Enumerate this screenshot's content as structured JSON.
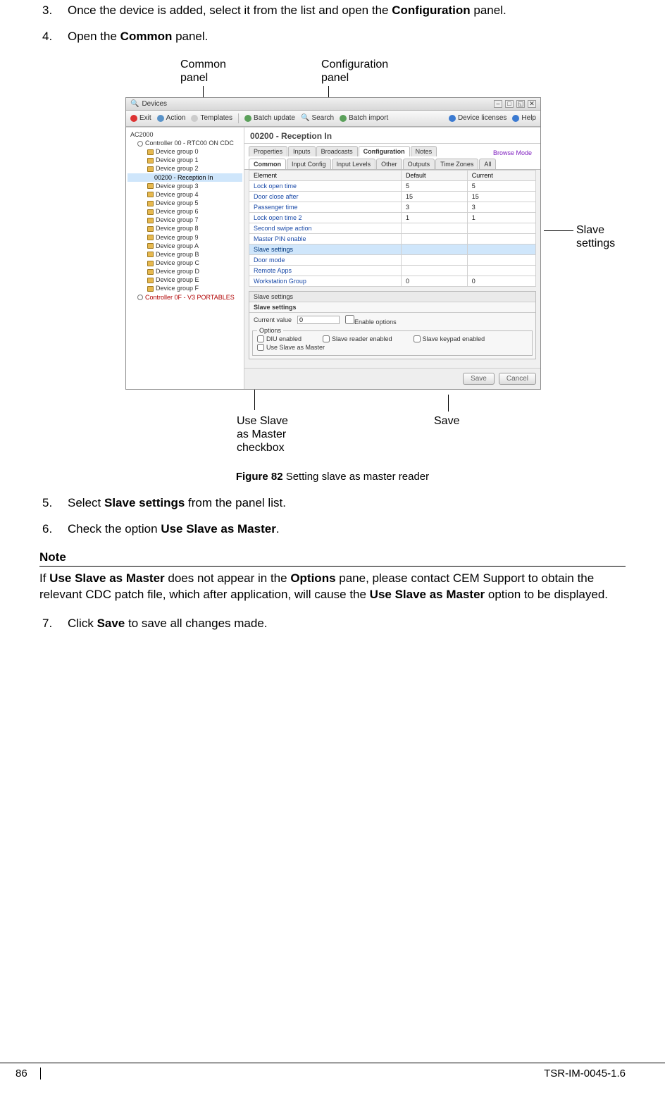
{
  "steps_a": [
    {
      "pre": "Once the device is added, select it from the list and open the ",
      "bold": "Configuration",
      "post": " panel."
    },
    {
      "pre": "Open the ",
      "bold": "Common",
      "post": " panel."
    }
  ],
  "annotations": {
    "common_panel": "Common panel",
    "common_panel_l1": "Common",
    "common_panel_l2": "panel",
    "config_panel": "Configuration panel",
    "config_panel_l1": "Configuration",
    "config_panel_l2": "panel",
    "slave_settings": "Slave settings",
    "slave_settings_l1": "Slave",
    "slave_settings_l2": "settings",
    "use_slave_cb": "Use Slave as Master checkbox",
    "use_slave_cb_l1": "Use Slave",
    "use_slave_cb_l2": "as Master",
    "use_slave_cb_l3": "checkbox",
    "save": "Save"
  },
  "app": {
    "title": "Devices",
    "toolbar": {
      "exit": "Exit",
      "action": "Action",
      "templates": "Templates",
      "batch_update": "Batch update",
      "search": "Search",
      "batch_import": "Batch import",
      "device_licenses": "Device licenses",
      "help": "Help"
    },
    "tree": [
      {
        "lv": 0,
        "label": "AC2000"
      },
      {
        "lv": 1,
        "label": "Controller 00 - RTC00 ON CDC",
        "ctrl": true
      },
      {
        "lv": 2,
        "label": "Device group 0",
        "folder": true
      },
      {
        "lv": 2,
        "label": "Device group 1",
        "folder": true
      },
      {
        "lv": 2,
        "label": "Device group 2",
        "folder": true
      },
      {
        "lv": 3,
        "label": "00200 - Reception In",
        "sel": true
      },
      {
        "lv": 2,
        "label": "Device group 3",
        "folder": true
      },
      {
        "lv": 2,
        "label": "Device group 4",
        "folder": true
      },
      {
        "lv": 2,
        "label": "Device group 5",
        "folder": true
      },
      {
        "lv": 2,
        "label": "Device group 6",
        "folder": true
      },
      {
        "lv": 2,
        "label": "Device group 7",
        "folder": true
      },
      {
        "lv": 2,
        "label": "Device group 8",
        "folder": true
      },
      {
        "lv": 2,
        "label": "Device group 9",
        "folder": true
      },
      {
        "lv": 2,
        "label": "Device group A",
        "folder": true
      },
      {
        "lv": 2,
        "label": "Device group B",
        "folder": true
      },
      {
        "lv": 2,
        "label": "Device group C",
        "folder": true
      },
      {
        "lv": 2,
        "label": "Device group D",
        "folder": true
      },
      {
        "lv": 2,
        "label": "Device group E",
        "folder": true
      },
      {
        "lv": 2,
        "label": "Device group F",
        "folder": true
      },
      {
        "lv": 1,
        "label": "Controller 0F - V3 PORTABLES",
        "ctrl": true,
        "red": true
      }
    ],
    "main": {
      "header": "00200 - Reception In",
      "tabs1": [
        "Properties",
        "Inputs",
        "Broadcasts",
        "Configuration",
        "Notes"
      ],
      "tabs1_active": 3,
      "browse_mode": "Browse Mode",
      "tabs2": [
        "Common",
        "Input Config",
        "Input Levels",
        "Other",
        "Outputs",
        "Time Zones",
        "All"
      ],
      "tabs2_active": 0,
      "grid_headers": [
        "Element",
        "Default",
        "Current"
      ],
      "grid_rows": [
        {
          "el": "Lock open time",
          "d": "5",
          "c": "5"
        },
        {
          "el": "Door close after",
          "d": "15",
          "c": "15"
        },
        {
          "el": "Passenger time",
          "d": "3",
          "c": "3"
        },
        {
          "el": "Lock open time 2",
          "d": "1",
          "c": "1"
        },
        {
          "el": "Second swipe action",
          "d": "",
          "c": ""
        },
        {
          "el": "Master PIN enable",
          "d": "",
          "c": ""
        },
        {
          "el": "Slave settings",
          "d": "",
          "c": "",
          "sel": true
        },
        {
          "el": "Door mode",
          "d": "",
          "c": ""
        },
        {
          "el": "Remote Apps",
          "d": "",
          "c": ""
        },
        {
          "el": "Workstation Group",
          "d": "0",
          "c": "0"
        }
      ],
      "slave_pane": {
        "title": "Slave settings",
        "subtitle": "Slave settings",
        "current_value_label": "Current value",
        "current_value": "0",
        "enable_options": "Enable options",
        "options_legend": "Options",
        "options": {
          "diu": "DIU enabled",
          "slave_reader": "Slave reader enabled",
          "slave_keypad": "Slave keypad enabled",
          "use_slave_master": "Use Slave as Master"
        }
      },
      "buttons": {
        "save": "Save",
        "cancel": "Cancel"
      }
    }
  },
  "figure_caption_bold": "Figure 82",
  "figure_caption_rest": " Setting slave as master reader",
  "steps_b": [
    {
      "pre": "Select ",
      "bold": "Slave settings",
      "post": " from the panel list."
    },
    {
      "pre": "Check the option ",
      "bold": "Use Slave as Master",
      "post": "."
    }
  ],
  "note_heading": "Note",
  "note": {
    "p1a": "If ",
    "p1b": "Use Slave as Master",
    "p1c": " does not appear in the ",
    "p1d": "Options",
    "p1e": " pane, please contact CEM Support to obtain the relevant CDC patch file, which after application, will cause the ",
    "p1f": "Use Slave as Master",
    "p1g": " option to be displayed."
  },
  "steps_c": [
    {
      "pre": "Click ",
      "bold": "Save",
      "post": " to save all changes made."
    }
  ],
  "pagefoot": {
    "page": "86",
    "doc": "TSR-IM-0045-1.6"
  }
}
